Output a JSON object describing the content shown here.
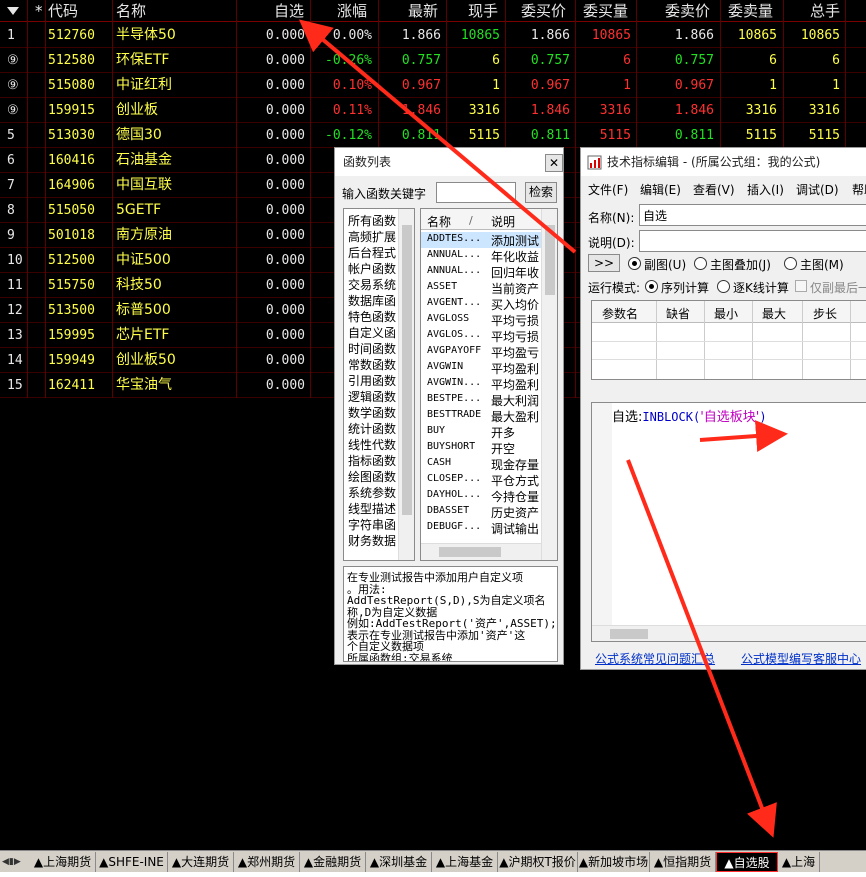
{
  "table": {
    "header_icon": "dropdown-triangle-icon",
    "headers": [
      "*",
      "代码",
      "名称",
      "自选",
      "涨幅",
      "最新",
      "现手",
      "委买价",
      "委买量",
      "委卖价",
      "委卖量",
      "总手"
    ],
    "rows": [
      {
        "idx": "1",
        "code": "512760",
        "name": "半导体50",
        "zx": "0.000",
        "chg": "0.00%",
        "last": "1.866",
        "vol": "10865",
        "bid": "1.866",
        "bidv": "10865",
        "ask": "1.866",
        "askv": "10865",
        "total": "10865",
        "chgc": "white",
        "lastc": "white",
        "bidc": "white",
        "askc": "white"
      },
      {
        "idx": "⑨",
        "code": "512580",
        "name": "环保ETF",
        "zx": "0.000",
        "chg": "-0.26%",
        "last": "0.757",
        "vol": "6",
        "bid": "0.757",
        "bidv": "6",
        "ask": "0.757",
        "askv": "6",
        "total": "6",
        "chgc": "green",
        "lastc": "green",
        "bidc": "green",
        "askc": "green"
      },
      {
        "idx": "⑨",
        "code": "515080",
        "name": "中证红利",
        "zx": "0.000",
        "chg": "0.10%",
        "last": "0.967",
        "vol": "1",
        "bid": "0.967",
        "bidv": "1",
        "ask": "0.967",
        "askv": "1",
        "total": "1",
        "chgc": "red",
        "lastc": "red",
        "bidc": "red",
        "askc": "red"
      },
      {
        "idx": "⑨",
        "code": "159915",
        "name": "创业板",
        "zx": "0.000",
        "chg": "0.11%",
        "last": "1.846",
        "vol": "3316",
        "bid": "1.846",
        "bidv": "3316",
        "ask": "1.846",
        "askv": "3316",
        "total": "3316",
        "chgc": "red",
        "lastc": "red",
        "bidc": "red",
        "askc": "red"
      },
      {
        "idx": "5",
        "code": "513030",
        "name": "德国30",
        "zx": "0.000",
        "chg": "-0.12%",
        "last": "0.811",
        "vol": "5115",
        "bid": "0.811",
        "bidv": "5115",
        "ask": "0.811",
        "askv": "5115",
        "total": "5115",
        "chgc": "green",
        "lastc": "green",
        "bidc": "green",
        "askc": "green"
      },
      {
        "idx": "6",
        "code": "160416",
        "name": "石油基金",
        "zx": "0.000"
      },
      {
        "idx": "7",
        "code": "164906",
        "name": "中国互联",
        "zx": "0.000"
      },
      {
        "idx": "8",
        "code": "515050",
        "name": "5GETF",
        "zx": "0.000"
      },
      {
        "idx": "9",
        "code": "501018",
        "name": "南方原油",
        "zx": "0.000"
      },
      {
        "idx": "10",
        "code": "512500",
        "name": "中证500",
        "zx": "0.000"
      },
      {
        "idx": "11",
        "code": "515750",
        "name": "科技50",
        "zx": "0.000"
      },
      {
        "idx": "12",
        "code": "513500",
        "name": "标普500",
        "zx": "0.000"
      },
      {
        "idx": "13",
        "code": "159995",
        "name": "芯片ETF",
        "zx": "0.000"
      },
      {
        "idx": "14",
        "code": "159949",
        "name": "创业板50",
        "zx": "0.000"
      },
      {
        "idx": "15",
        "code": "162411",
        "name": "华宝油气",
        "zx": "0.000"
      }
    ]
  },
  "func_dialog": {
    "title": "函数列表",
    "close_icon": "close-icon",
    "keyword_label": "输入函数关键字",
    "keyword_value": "",
    "search_button": "检索",
    "categories": [
      "所有函数",
      "高频扩展",
      "后台程式",
      "帐户函数",
      "交易系统",
      "数据库函",
      "特色函数",
      "自定义函",
      "时间函数",
      "常数函数",
      "引用函数",
      "逻辑函数",
      "数学函数",
      "统计函数",
      "线性代数",
      "指标函数",
      "绘图函数",
      "系统参数",
      "线型描述",
      "字符串函",
      "财务数据"
    ],
    "col_name": "名称",
    "col_sort": "/",
    "col_desc": "说明",
    "functions": [
      {
        "name": "ADDTES...",
        "desc": "添加测试"
      },
      {
        "name": "ANNUAL...",
        "desc": "年化收益"
      },
      {
        "name": "ANNUAL...",
        "desc": "回归年收"
      },
      {
        "name": "ASSET",
        "desc": "当前资产"
      },
      {
        "name": "AVGENT...",
        "desc": "买入均价"
      },
      {
        "name": "AVGLOSS",
        "desc": "平均亏损"
      },
      {
        "name": "AVGLOS...",
        "desc": "平均亏损"
      },
      {
        "name": "AVGPAYOFF",
        "desc": "平均盈亏"
      },
      {
        "name": "AVGWIN",
        "desc": "平均盈利"
      },
      {
        "name": "AVGWIN...",
        "desc": "平均盈利"
      },
      {
        "name": "BESTPE...",
        "desc": "最大利润"
      },
      {
        "name": "BESTTRADE",
        "desc": "最大盈利"
      },
      {
        "name": "BUY",
        "desc": "开多"
      },
      {
        "name": "BUYSHORT",
        "desc": "开空"
      },
      {
        "name": "CASH",
        "desc": "现金存量"
      },
      {
        "name": "CLOSEP...",
        "desc": "平仓方式"
      },
      {
        "name": "DAYHOL...",
        "desc": "今持仓量"
      },
      {
        "name": "DBASSET",
        "desc": "历史资产"
      },
      {
        "name": "DEBUGF...",
        "desc": "调试输出"
      }
    ],
    "help_lines": [
      "在专业测试报告中添加用户自定义项",
      "。用法:",
      "AddTestReport(S,D),S为自定义项名",
      "称,D为自定义数据",
      "例如:AddTestReport('资产',ASSET);",
      "表示在专业测试报告中添加'资产'这",
      "个自定义数据项",
      "所属函数组:交易系统"
    ]
  },
  "editor": {
    "title": "技术指标编辑 - (所属公式组：我的公式)",
    "app_icon": "formula-editor-icon",
    "menus": [
      "文件(F)",
      "编辑(E)",
      "查看(V)",
      "插入(I)",
      "调试(D)",
      "帮助"
    ],
    "name_label": "名称(N):",
    "name_value": "自选",
    "desc_label": "说明(D):",
    "desc_value": "",
    "expand_button": ">>",
    "radio_sub": "副图(U)",
    "radio_overlay": "主图叠加(J)",
    "radio_main": "主图(M)",
    "run_mode_label": "运行模式:",
    "radio_seq": "序列计算",
    "radio_step": "逐K线计算",
    "check_last": "仅副最后一",
    "param_headers": [
      "参数名",
      "缺省",
      "最小",
      "最大",
      "步长"
    ],
    "code_var": "自选",
    "code_colon": ":",
    "code_fn": "INBLOCK(",
    "code_str": "'自选板块'",
    "code_close": ")",
    "link_faq": "公式系统常见问题汇总",
    "link_service": "公式模型编写客服中心"
  },
  "tabs": [
    "▲上海期货",
    "▲SHFE-INE",
    "▲大连期货",
    "▲郑州期货",
    "▲金融期货",
    "▲深圳基金",
    "▲上海基金",
    "▲沪期权T报价",
    "▲新加坡市场",
    "▲恒指期货",
    "▲自选股",
    "▲上海"
  ],
  "tabs_active": 10,
  "tab_scroll_icon": "tab-scroll-arrows-icon",
  "colors": {
    "accent_red": "#ff3030",
    "quote_yellow": "#ffff4a",
    "down_green": "#22e022"
  }
}
